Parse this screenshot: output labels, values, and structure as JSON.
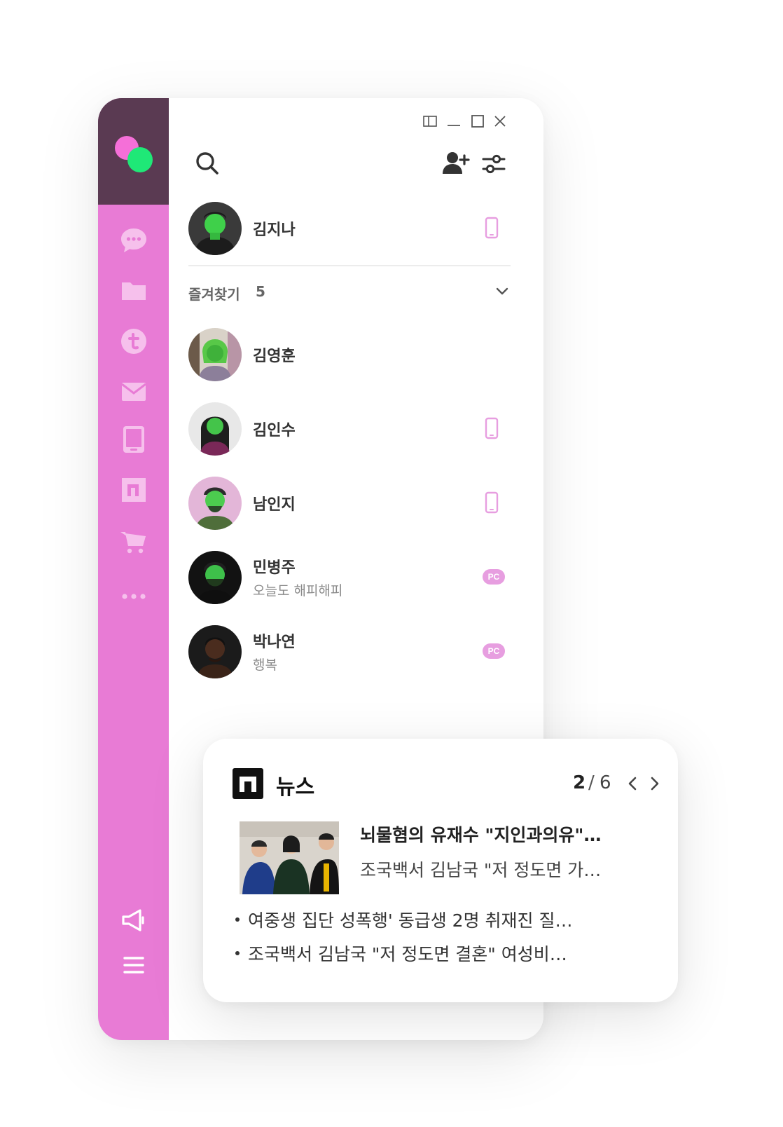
{
  "window_controls": [
    "split-view",
    "minimize",
    "maximize",
    "close"
  ],
  "colors": {
    "sidebar": "#e87bd5",
    "sidebar_header": "#5a3a52",
    "logo_pink": "#f56fd8",
    "logo_green": "#1fe877",
    "device_icon": "#e79ee0"
  },
  "sidebar": {
    "items": [
      {
        "icon": "chat-bubble-icon"
      },
      {
        "icon": "folder-icon"
      },
      {
        "icon": "t-circle-icon"
      },
      {
        "icon": "mail-icon"
      },
      {
        "icon": "tablet-icon"
      },
      {
        "icon": "n-square-icon"
      },
      {
        "icon": "cart-icon"
      },
      {
        "icon": "more-dots-icon"
      }
    ],
    "bottom": [
      {
        "icon": "megaphone-icon"
      },
      {
        "icon": "hamburger-menu-icon"
      }
    ]
  },
  "toolbar": {
    "search_icon": "search-icon",
    "add_friend_icon": "add-friend-icon",
    "settings_icon": "sliders-icon"
  },
  "me": {
    "name": "김지나",
    "device": "mobile"
  },
  "favorites": {
    "label": "즐겨찾기",
    "count": "5"
  },
  "friends": [
    {
      "name": "김영훈",
      "status": "",
      "device": ""
    },
    {
      "name": "김인수",
      "status": "",
      "device": "mobile"
    },
    {
      "name": "남인지",
      "status": "",
      "device": "mobile"
    },
    {
      "name": "민병주",
      "status": "오늘도 해피해피",
      "device": "PC"
    },
    {
      "name": "박나연",
      "status": "행복",
      "device": "PC"
    }
  ],
  "news": {
    "title": "뉴스",
    "page_current": "2",
    "page_separator": "/",
    "page_total": "6",
    "headline": "뇌물혐의 유재수 \"지인과의유\"…",
    "subhead": "조국백서 김남국 \"저 정도면 가…",
    "bullets": [
      "여중생 집단 성폭행' 동급생 2명 취재진 질…",
      "조국백서 김남국 \"저 정도면 결혼\" 여성비…"
    ]
  }
}
